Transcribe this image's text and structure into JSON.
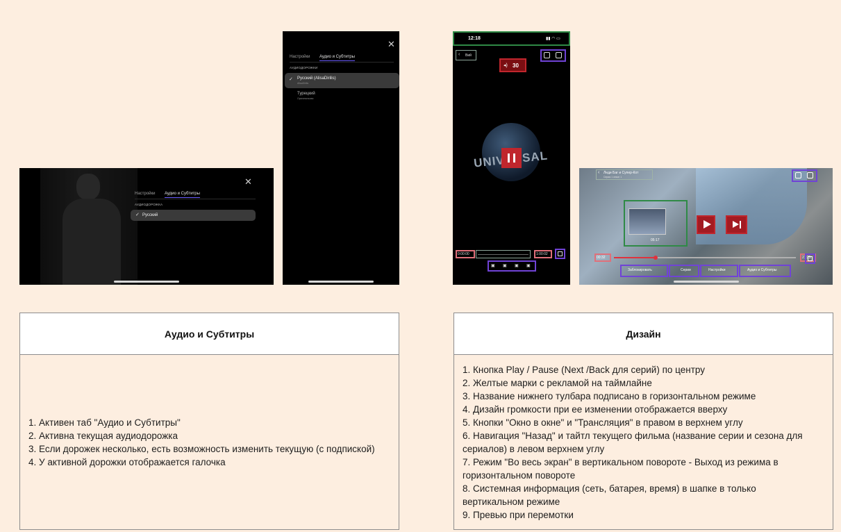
{
  "colors": {
    "page_bg": "#fdeee0",
    "annotation_red": "#c0262d",
    "annotation_purple": "#7043d6",
    "annotation_green": "#2f8a46",
    "annotation_pink": "#e0707a",
    "active_tab_underline": "#6a5cff"
  },
  "screen_landscape_audio": {
    "tab_settings": "Настройки",
    "tab_audio": "Аудио и Субтитры",
    "section_label": "АУДИОДОРОЖКА",
    "active_track": "Русский",
    "close_icon": "close-icon"
  },
  "screen_portrait_audio": {
    "tab_settings": "Настройки",
    "tab_audio": "Аудио и Субтитры",
    "section_label": "АУДИОДОРОЖКИ",
    "tracks": [
      {
        "name": "Русский (AlisaDirilis)",
        "sub": "AlisaDirilis",
        "active": true
      },
      {
        "name": "Турецкий",
        "sub": "Оригинальная",
        "active": false
      }
    ],
    "close_icon": "close-icon"
  },
  "screen_portrait_player": {
    "status_time": "12:18",
    "back_label": "Вий",
    "volume_value": "30",
    "time_current": "0:00:00",
    "time_total": "1:00:02",
    "logo_text": "UNIVERSAL"
  },
  "screen_landscape_player": {
    "title": "Леди Баг и Супер-Кот",
    "subtitle": "Серия 1 сезон 1",
    "preview_time": "05:17",
    "time_current": "00:32",
    "time_total": "21:25",
    "toolbar": [
      "Заблокировать",
      "Серии",
      "Настройки",
      "Аудио и Субтитры"
    ]
  },
  "table_audio": {
    "header": "Аудио и Субтитры",
    "items": [
      "1. Активен таб \"Аудио и Субтитры\"",
      "2. Активна текущая аудиодорожка",
      "3. Если дорожек несколько, есть возможность изменить текущую (с подпиской)",
      "4. У активной дорожки отображается галочка"
    ]
  },
  "table_design": {
    "header": "Дизайн",
    "items": [
      "1. Кнопка Play / Pause (Next /Back для серий) по центру",
      "2. Желтые марки с рекламой на таймлайне",
      "3. Название нижнего тулбара подписано в горизонтальном режиме",
      "4. Дизайн громкости при ее изменении отображается вверху",
      "5. Кнопки \"Окно в окне\" и \"Трансляция\" в правом в верхнем углу",
      "6. Навигация \"Назад\" и тайтл текущего фильма (название серии и сезона для сериалов) в левом верхнем углу",
      "7. Режим \"Во весь экран\" в вертикальном повороте - Выход из режима в горизонтальном повороте",
      "8. Системная информация (сеть, батарея, время) в шапке в только вертикальном режиме",
      "9. Превью при перемотки"
    ]
  }
}
